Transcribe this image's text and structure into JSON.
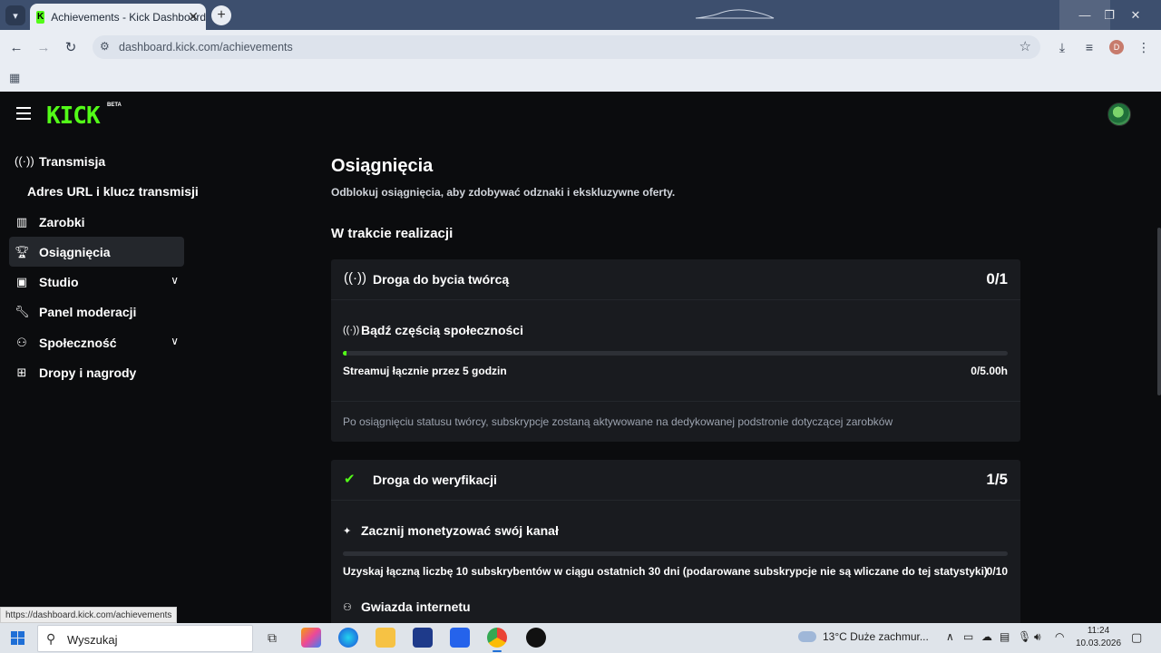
{
  "browser": {
    "tab_title": "Achievements - Kick Dashboard",
    "url": "dashboard.kick.com/achievements",
    "profile_initial": "D",
    "status_url": "https://dashboard.kick.com/achievements"
  },
  "header": {
    "logo": "KICK",
    "beta": "BETA"
  },
  "sidebar": {
    "items": [
      {
        "label": "Transmisja",
        "icon": "broadcast-icon"
      },
      {
        "label": "Adres URL i klucz transmisji",
        "icon": ""
      },
      {
        "label": "Zarobki",
        "icon": "chart-icon"
      },
      {
        "label": "Osiągnięcia",
        "icon": "trophy-icon",
        "active": true
      },
      {
        "label": "Studio",
        "icon": "studio-icon",
        "expandable": true
      },
      {
        "label": "Panel moderacji",
        "icon": "wrench-icon"
      },
      {
        "label": "Społeczność",
        "icon": "community-icon",
        "expandable": true
      },
      {
        "label": "Dropy i nagrody",
        "icon": "gift-icon"
      }
    ]
  },
  "main": {
    "title": "Osiągnięcia",
    "subtitle": "Odblokuj osiągnięcia, aby zdobywać odznaki i ekskluzywne oferty.",
    "section_title": "W trakcie realizacji",
    "cards": [
      {
        "title": "Droga do bycia twórcą",
        "count": "0/1",
        "task_title": "Bądź częścią społeczności",
        "requirement": "Streamuj łącznie przez 5 godzin",
        "value": "0/5.00h",
        "progress": 0.005,
        "note": "Po osiągnięciu statusu twórcy, subskrypcje zostaną aktywowane na dedykowanej podstronie dotyczącej zarobków"
      },
      {
        "title": "Droga do weryfikacji",
        "count": "1/5",
        "task_title": "Zacznij monetyzować swój kanał",
        "requirement": "Uzyskaj łączną liczbę 10 subskrybentów w ciągu ostatnich 30 dni (podarowane subskrypcje nie są wliczane do tej statystyki)",
        "value": "0/10",
        "progress": 0,
        "task2_title": "Gwiazda internetu"
      }
    ]
  },
  "taskbar": {
    "search_placeholder": "Wyszukaj",
    "weather": "13°C  Duże zachmur...",
    "time": "11:24",
    "date": "10.03.2026"
  },
  "colors": {
    "accent": "#53fc18",
    "background": "#0b0c0e",
    "card": "#191b1f"
  }
}
